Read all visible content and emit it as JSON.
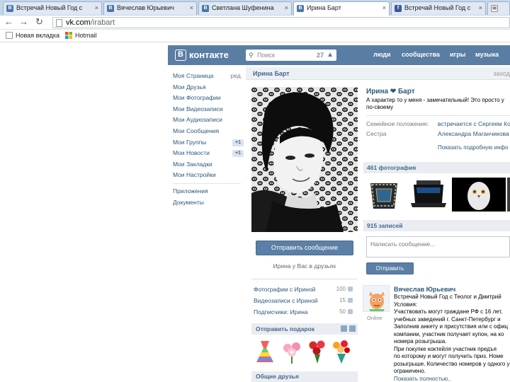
{
  "browser": {
    "tabs": [
      {
        "label": "Встречай Новый Год с",
        "active": false
      },
      {
        "label": "Вячеслав Юрьевич",
        "active": false
      },
      {
        "label": "Светлана Шуфенина",
        "active": false
      },
      {
        "label": "Ирина Барт",
        "active": true
      },
      {
        "label": "Встречай Новый Год с",
        "active": false
      }
    ],
    "close_glyph": "×",
    "url_domain": "vk.com",
    "url_path": "/irabart",
    "bookmarks": [
      {
        "label": "Новая вкладка"
      },
      {
        "label": "Hotmail"
      }
    ]
  },
  "vk": {
    "logo_letter": "В",
    "logo_text": "контакте",
    "search_placeholder": "Поиск",
    "search_count": "27",
    "nav": [
      "люди",
      "сообщества",
      "игры",
      "музыка"
    ],
    "accent": "#597da3"
  },
  "sidebar": {
    "items": [
      {
        "label": "Моя Страница",
        "extra": "ред."
      },
      {
        "label": "Мои Друзья"
      },
      {
        "label": "Мои Фотографии"
      },
      {
        "label": "Мои Видеозаписи"
      },
      {
        "label": "Мои Аудиозаписи"
      },
      {
        "label": "Мои Сообщения"
      },
      {
        "label": "Мои Группы",
        "badge": "+1"
      },
      {
        "label": "Мои Новости",
        "badge": "+1"
      },
      {
        "label": "Мои Закладки"
      },
      {
        "label": "Мои Настройки"
      }
    ],
    "extra_items": [
      {
        "label": "Приложения"
      },
      {
        "label": "Документы"
      }
    ]
  },
  "page": {
    "title": "Ирина Барт",
    "title_right": "заход",
    "send_message": "Отправить сообщение",
    "friends_note": "Ирина у Вас в друзьях",
    "left_rows": [
      {
        "label": "Фотографии с Ириной",
        "count": "100"
      },
      {
        "label": "Видеозаписи с Ириной",
        "count": "15"
      },
      {
        "label": "Подписчики: Ирина",
        "count": "50"
      }
    ],
    "gifts_title": "Отправить подарок",
    "common_friends": "Общие друзья"
  },
  "profile": {
    "name": "Ирина ❤ Барт",
    "status_line1": "А характер то у меня - замечательный! Это просто у",
    "status_line2": "по-своему",
    "info": [
      {
        "label": "Семейное положение:",
        "value": "встречается с Сергеем Ко"
      },
      {
        "label": "Сестра",
        "value": "Александра Маганчикова"
      }
    ],
    "show_more": "Показать подробную инфо"
  },
  "photos": {
    "title": "461 фотография"
  },
  "wall": {
    "title": "915 записей",
    "placeholder": "Написать сообщение...",
    "send_label": "Отправить",
    "post": {
      "author": "Вячеслав Юрьевич",
      "online": "Online",
      "lines": [
        "Встречай Новый Год с Теолог и Дмитрий",
        "Условия:",
        "Участвовать могут граждане РФ с 16 лет,",
        "учебных заведений г. Санкт-Петербург и",
        "Заполнив анкету и присутствия или с офиц",
        "компании, участник получает купон, на ко",
        "номера розыгрыша.",
        "При покупке коктейля участник предъя",
        "по которому и могут получить приз. Номе",
        "розыгрыше. Количество номеров у одного учас",
        "ограничено."
      ],
      "more": "Показать полностью.."
    }
  }
}
